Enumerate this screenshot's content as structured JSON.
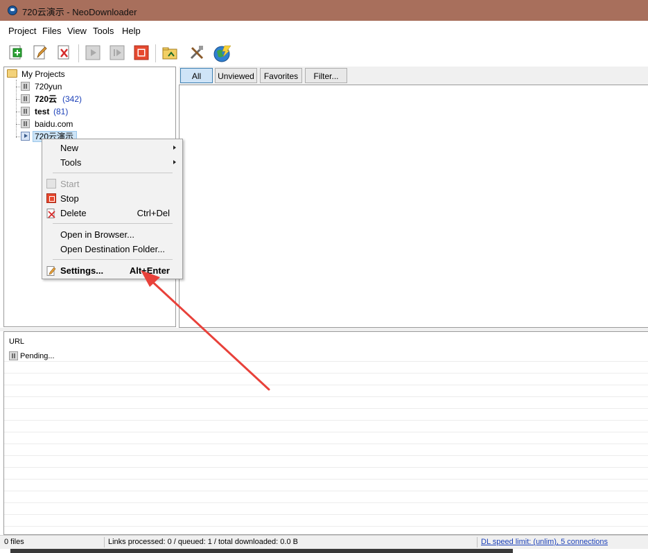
{
  "window": {
    "title": "720云演示 - NeoDownloader"
  },
  "menubar": {
    "items": [
      {
        "label": "Project",
        "key": "P"
      },
      {
        "label": "Files",
        "key": "F"
      },
      {
        "label": "View",
        "key": "V"
      },
      {
        "label": "Tools",
        "key": "T"
      },
      {
        "label": "Help",
        "key": "H"
      }
    ]
  },
  "toolbar": {
    "buttons": [
      {
        "icon": "new-project-icon"
      },
      {
        "icon": "edit-project-icon"
      },
      {
        "icon": "delete-project-icon"
      },
      {
        "icon": "start-icon"
      },
      {
        "icon": "start-selected-icon"
      },
      {
        "icon": "stop-icon"
      },
      {
        "icon": "open-folder-icon"
      },
      {
        "icon": "tools-icon"
      },
      {
        "icon": "globe-icon"
      }
    ]
  },
  "tree": {
    "root": "My Projects",
    "items": [
      {
        "label": "720yun",
        "count": "",
        "bold": false,
        "state": "paused"
      },
      {
        "label": "720云",
        "count": "(342)",
        "bold": true,
        "state": "paused"
      },
      {
        "label": "test",
        "count": "(81)",
        "bold": true,
        "state": "paused"
      },
      {
        "label": "baidu.com",
        "count": "",
        "bold": false,
        "state": "paused"
      },
      {
        "label": "720云演示",
        "count": "",
        "bold": false,
        "state": "running",
        "selected": true
      }
    ]
  },
  "filter_tabs": [
    {
      "label": "All",
      "active": true
    },
    {
      "label": "Unviewed",
      "active": false
    },
    {
      "label": "Favorites",
      "active": false
    },
    {
      "label": "Filter...",
      "active": false
    }
  ],
  "url_pane": {
    "header": "URL",
    "rows": [
      {
        "status": "Pending..."
      }
    ]
  },
  "context_menu": {
    "items": [
      {
        "label": "New",
        "submenu": true
      },
      {
        "label": "Tools",
        "submenu": true
      },
      {
        "label": "Start",
        "disabled": true
      },
      {
        "label": "Stop"
      },
      {
        "label": "Delete",
        "shortcut": "Ctrl+Del"
      },
      {
        "label": "Open in Browser..."
      },
      {
        "label": "Open Destination Folder..."
      },
      {
        "label": "Settings...",
        "shortcut": "Alt+Enter",
        "bold": true
      }
    ]
  },
  "statusbar": {
    "files": "0 files",
    "progress": "Links processed: 0 / queued: 1 / total downloaded: 0.0 B",
    "speed": "DL speed limit: (unlim), 5 connections"
  },
  "colors": {
    "titlebar": "#a86f5c",
    "annotation_arrow": "#e8413a",
    "count_text": "#1a3fb8"
  }
}
